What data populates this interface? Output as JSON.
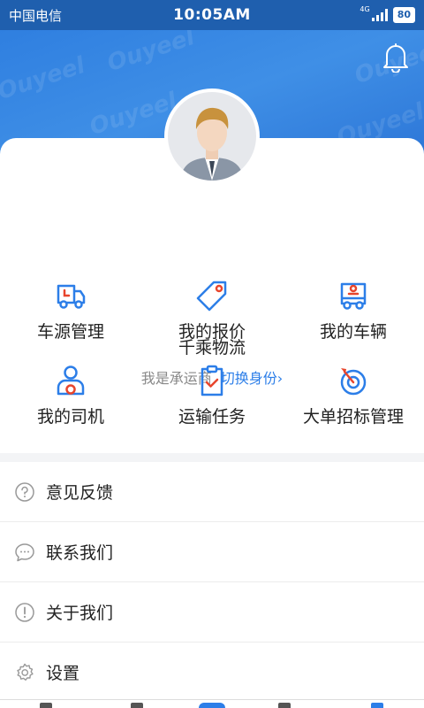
{
  "status_bar": {
    "carrier": "中国电信",
    "time": "10:05AM",
    "network": "4G",
    "battery": "80"
  },
  "watermark": "Ouyeel",
  "profile": {
    "company": "千乘物流",
    "role": "我是承运商",
    "switch_label": "切换身份›"
  },
  "grid": [
    {
      "label": "车源管理",
      "icon": "truck-icon"
    },
    {
      "label": "我的报价",
      "icon": "price-tag-icon"
    },
    {
      "label": "我的车辆",
      "icon": "vehicle-icon"
    },
    {
      "label": "我的司机",
      "icon": "driver-icon"
    },
    {
      "label": "运输任务",
      "icon": "clipboard-check-icon"
    },
    {
      "label": "大单招标管理",
      "icon": "target-icon"
    }
  ],
  "menu": [
    {
      "label": "意见反馈",
      "icon": "question-icon"
    },
    {
      "label": "联系我们",
      "icon": "chat-icon"
    },
    {
      "label": "关于我们",
      "icon": "info-icon"
    },
    {
      "label": "设置",
      "icon": "gear-icon"
    }
  ],
  "colors": {
    "primary": "#2c7ee8",
    "accent": "#e8452c",
    "status_bar": "#1f5fae"
  }
}
